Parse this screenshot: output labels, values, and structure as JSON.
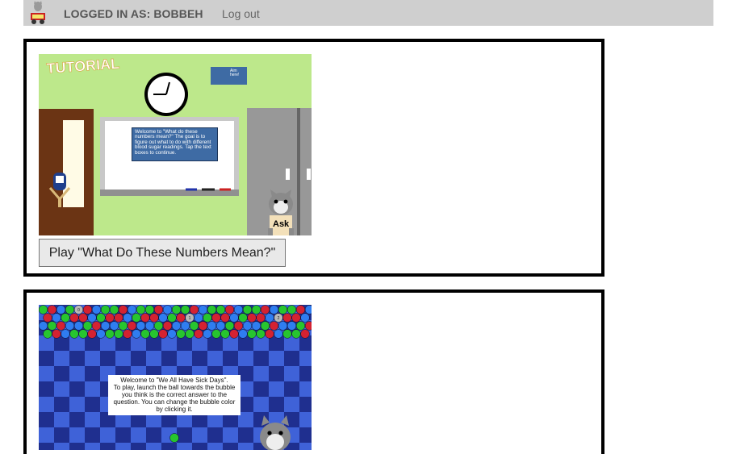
{
  "header": {
    "login_text": "LOGGED IN AS: BOBBEH",
    "logout_label": "Log out"
  },
  "games": [
    {
      "tutorial_badge": "TUTORIAL",
      "help_badge": "Aim here!",
      "message": "Welcome to \"What do these numbers mean?\" The goal is to figure out what to do with different blood sugar readings. Tap the text boxes to continue.",
      "ask_label": "Ask",
      "play_label": "Play \"What Do These Numbers Mean?\""
    },
    {
      "bubble_numbers": [
        "0",
        "1",
        "2"
      ],
      "message_line1": "Welcome to \"We All Have Sick Days\".",
      "message_line2": "To play, launch the ball towards the bubble you think is the correct answer to the question. You can change the bubble color by clicking it."
    }
  ],
  "colors": {
    "topbar": "#cfcfcf",
    "tutorial_bg": "#bde88b",
    "checker_dark": "#1f2f8f",
    "checker_light": "#3f62d8"
  }
}
